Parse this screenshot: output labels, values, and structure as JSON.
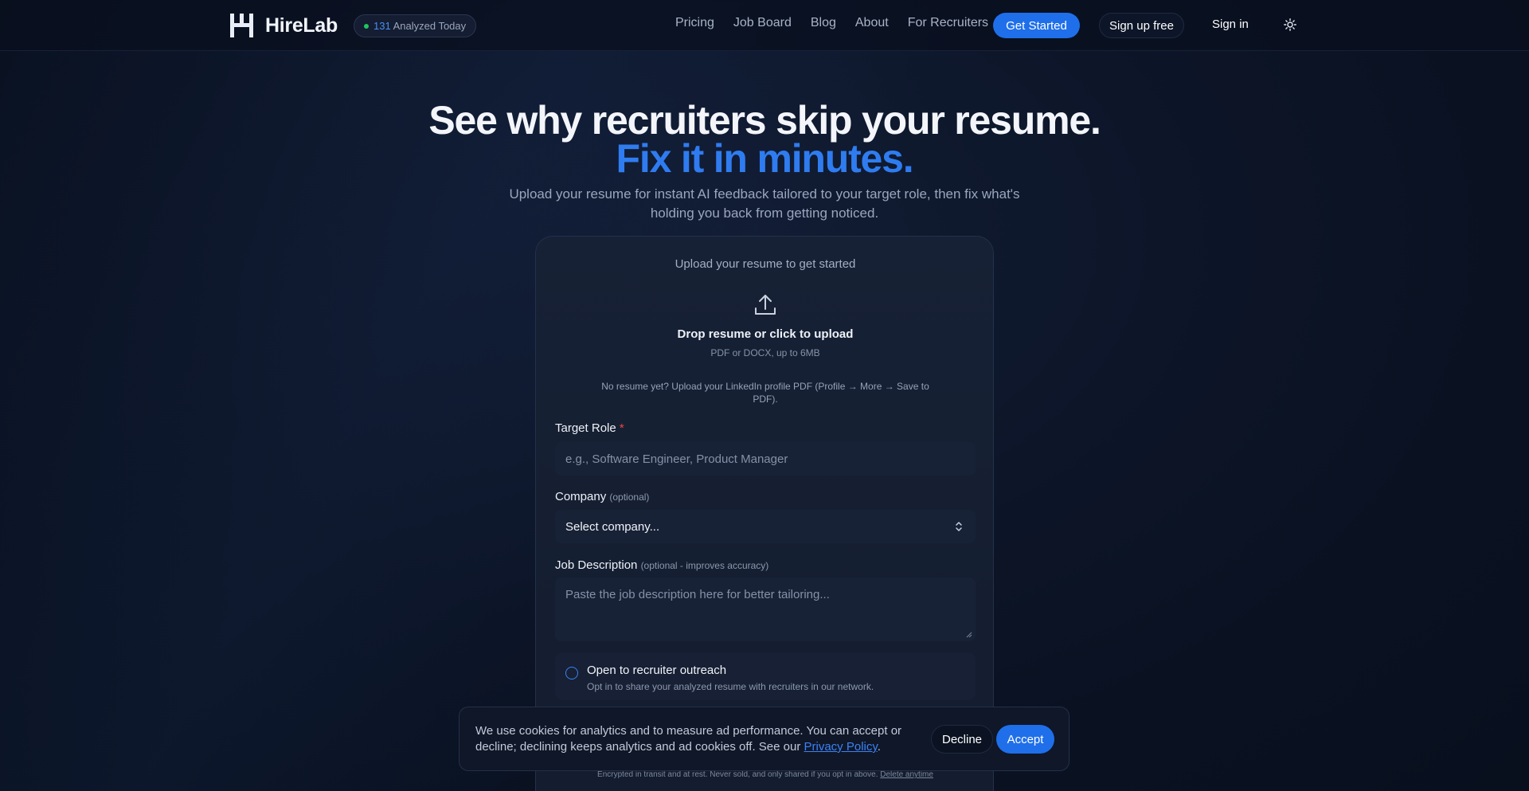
{
  "app": {
    "name": "HireLab",
    "badge_count": "131",
    "badge_label": " Analyzed Today"
  },
  "nav": {
    "links": [
      "Pricing",
      "Job Board",
      "Blog",
      "About",
      "For Recruiters"
    ],
    "get_started": "Get Started",
    "sign_up": "Sign up free",
    "sign_in": "Sign in"
  },
  "hero": {
    "headline": "See why recruiters skip your resume.",
    "headline_accent": "Fix it in minutes.",
    "subtitle": "Upload your resume for instant AI feedback tailored to your target role, then fix what's holding you back from getting noticed."
  },
  "form": {
    "card_title": "Upload your resume to get started",
    "drop_label": "Drop resume or click to upload",
    "drop_hint": "PDF or DOCX, up to 6MB",
    "linkedin_hint": "No resume yet? Upload your LinkedIn profile PDF (Profile → More → Save to PDF).",
    "target_role_label": "Target Role",
    "target_role_required": "*",
    "target_role_placeholder": "e.g., Software Engineer, Product Manager",
    "company_label": "Company",
    "company_optional": "(optional)",
    "company_value": "Select company...",
    "jd_label": "Job Description",
    "jd_optional": "(optional - improves accuracy)",
    "jd_placeholder": "Paste the job description here for better tailoring...",
    "outreach_title": "Open to recruiter outreach",
    "outreach_sub": "Opt in to share your analyzed resume with recruiters in our network.",
    "footer_note": "Encrypted in transit and at rest. Never sold, and only shared if you opt in above. ",
    "footer_link": "Delete anytime"
  },
  "cookie": {
    "text": "We use cookies for analytics and to measure ad performance. You can accept or decline; declining keeps analytics and ad cookies off. See our ",
    "link": "Privacy Policy",
    "text_end": ".",
    "decline": "Decline",
    "accept": "Accept"
  },
  "colors": {
    "accent": "#1f6fea",
    "accent_text": "#2f7cf0",
    "background": "#0b1324",
    "status_dot": "#22c55e",
    "required": "#ef4444"
  }
}
